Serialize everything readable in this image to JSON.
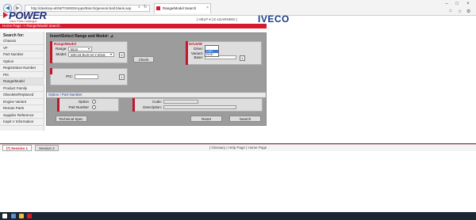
{
  "browser": {
    "url": "http://desktop-ahh8/TG6000/Apps/Bisrch/general.ball.blank.asp",
    "tab_title": "Range/Model Search",
    "back_glyph": "◀",
    "forward_glyph": "▶",
    "home_icon": "home-icon",
    "star_icon": "star-icon",
    "gear_icon": "gear-icon"
  },
  "app": {
    "logo": "POWER",
    "logo_sub": "Iveco Parts Catalogue",
    "header_links": "| HELP ▾   |   E-LEARNING |",
    "brand": "IVECO",
    "breadcrumb": "Home Page -> Range/Model Search"
  },
  "sidebar": {
    "title": "Search for:",
    "items": [
      {
        "label": "Chassis"
      },
      {
        "label": "VF"
      },
      {
        "label": "Part Number"
      },
      {
        "label": "Option"
      },
      {
        "label": "Registration Number"
      },
      {
        "label": "PIC"
      },
      {
        "label": "Range/Model"
      },
      {
        "label": "Product Family"
      },
      {
        "label": "Obsolete/Replaced"
      },
      {
        "label": "Engine Variant"
      },
      {
        "label": "Reman Parts"
      },
      {
        "label": "Supplier Reference"
      },
      {
        "label": "Kapit V Information"
      }
    ]
  },
  "main": {
    "title": "Insert/Select Range and Model: ⊿",
    "range_model": {
      "title": "Range/Model",
      "range_label": "Range:",
      "range_value": "BUS",
      "model_label": "Model:",
      "model_value": "MIC18 BUS M.Y.2016"
    },
    "check_button": "Check",
    "pic_label": "PIC:",
    "drive_group": {
      "title": "Drive/W",
      "drive_label": "Drive:",
      "drive_value": "LHD",
      "variant_label": "Variant:",
      "base_label": "Base:",
      "dropdown_options": [
        "",
        "LHD",
        "RHD"
      ],
      "dropdown_selected": "LHD"
    },
    "option_section": {
      "title": "Option / Part Number",
      "option_label": "Option",
      "part_number_label": "Part Number",
      "code_label": "Code:",
      "description_label": "Description:"
    },
    "buttons": {
      "technical_spec": "Technical Spec.",
      "reset": "Reset",
      "search": "Search"
    }
  },
  "footer": {
    "session1": "(*) Session 1",
    "session2": "Session 2",
    "links": "| Glossary | Help Page | Home Page"
  },
  "colors": {
    "accent_red": "#d7192e",
    "brand_blue": "#163c86",
    "panel_gray": "#9c9c9c"
  }
}
